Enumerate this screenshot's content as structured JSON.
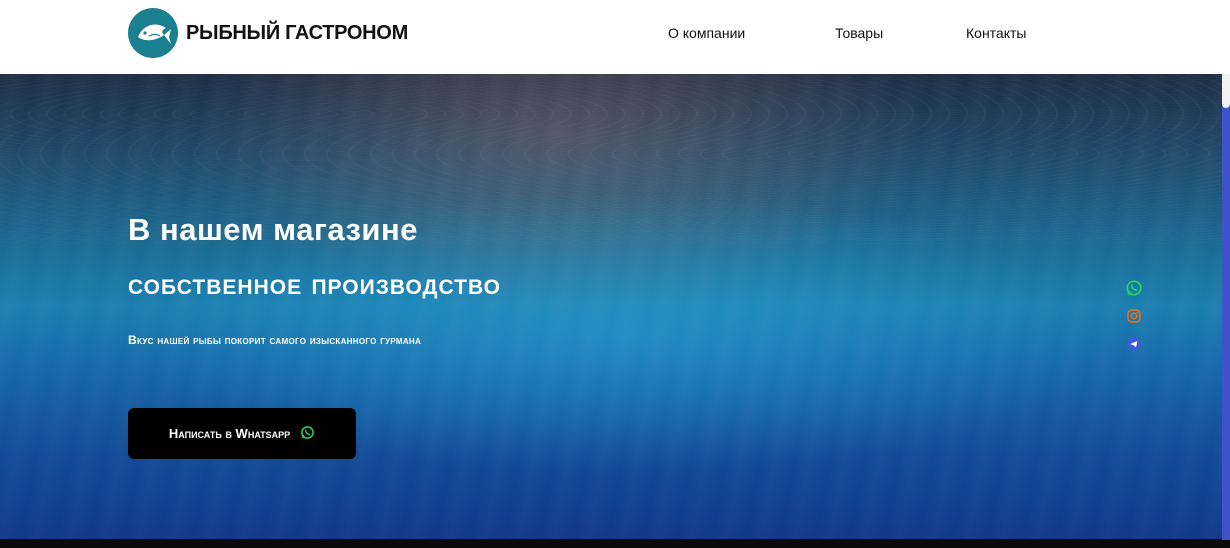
{
  "header": {
    "logo_text": "РЫБНЫЙ ГАСТРОНОМ",
    "nav": [
      {
        "label": "О компании"
      },
      {
        "label": "Товары"
      },
      {
        "label": "Контакты"
      }
    ]
  },
  "hero": {
    "title_line1": "В нашем магазине",
    "title_line2": "собственное производство",
    "subtitle": "Вкус нашей рыбы покорит самого изысканного гурмана",
    "cta_label": "Написать в Whatsapp"
  },
  "social": {
    "icons": [
      "whatsapp-icon",
      "instagram-icon",
      "telegram-icon"
    ]
  },
  "colors": {
    "logo_badge": "#1a7f8e",
    "whatsapp": "#25d366",
    "instagram": "#e4701e",
    "telegram": "#3f5bd6",
    "cta_bg": "#000000"
  }
}
